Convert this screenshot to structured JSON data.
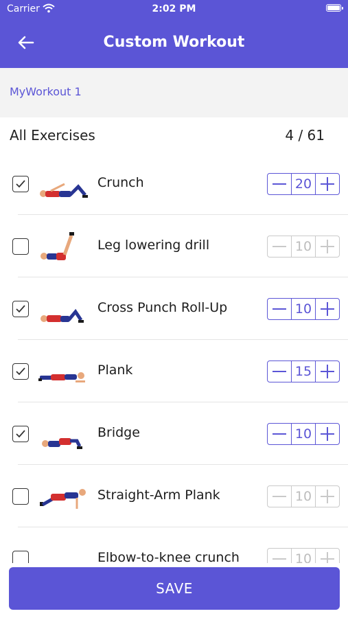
{
  "status_bar": {
    "carrier": "Carrier",
    "time": "2:02 PM"
  },
  "header": {
    "title": "Custom Workout"
  },
  "workout": {
    "name": "MyWorkout 1"
  },
  "list": {
    "label": "All Exercises",
    "count": "4 / 61"
  },
  "exercises": [
    {
      "name": "Crunch",
      "checked": true,
      "value": "20"
    },
    {
      "name": "Leg lowering drill",
      "checked": false,
      "value": "10"
    },
    {
      "name": "Cross Punch Roll-Up",
      "checked": true,
      "value": "10"
    },
    {
      "name": "Plank",
      "checked": true,
      "value": "15"
    },
    {
      "name": "Bridge",
      "checked": true,
      "value": "10"
    },
    {
      "name": "Straight-Arm Plank",
      "checked": false,
      "value": "10"
    },
    {
      "name": "Elbow-to-knee crunch",
      "checked": false,
      "value": "10"
    }
  ],
  "footer": {
    "save_label": "SAVE"
  },
  "colors": {
    "accent": "#5b55d6",
    "disabled": "#c9c9c9"
  },
  "icons": {
    "back": "arrow-left-icon",
    "checkbox": "checkmark-icon",
    "minus": "minus-icon",
    "plus": "plus-icon",
    "wifi": "wifi-icon",
    "battery": "battery-icon"
  }
}
